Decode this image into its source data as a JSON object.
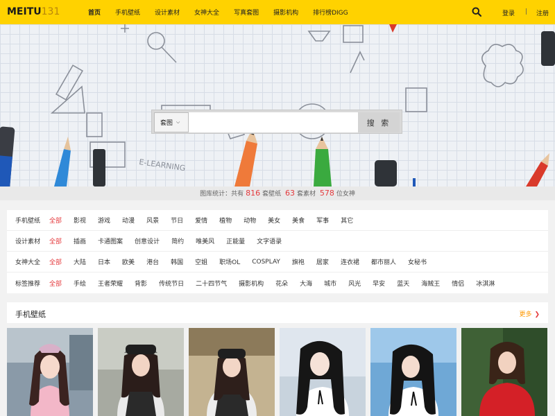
{
  "header": {
    "logo_text": "MEITU",
    "logo_num": "131",
    "nav": [
      "首页",
      "手机壁纸",
      "设计素材",
      "女神大全",
      "写真套图",
      "摄影机构",
      "排行榜DIGG"
    ],
    "login": "登录",
    "separator": "|",
    "register": "注册"
  },
  "search": {
    "select_value": "套图",
    "placeholder": "",
    "button": "搜 索"
  },
  "stats": {
    "prefix": "图库统计：共有",
    "wallpapers": "816",
    "wallpapers_unit": "套壁纸",
    "materials": "63",
    "materials_unit": "套素材",
    "goddess": "578",
    "goddess_unit": "位女神"
  },
  "filters": [
    {
      "cat": "手机壁纸",
      "tags": [
        "全部",
        "影视",
        "游戏",
        "动漫",
        "风景",
        "节日",
        "爱情",
        "植物",
        "动物",
        "美女",
        "美食",
        "军事",
        "其它"
      ]
    },
    {
      "cat": "设计素材",
      "tags": [
        "全部",
        "插画",
        "卡通图案",
        "创意设计",
        "简约",
        "唯美风",
        "正能量",
        "文字语录"
      ]
    },
    {
      "cat": "女神大全",
      "tags": [
        "全部",
        "大陆",
        "日本",
        "欧美",
        "港台",
        "韩国",
        "空姐",
        "职场OL",
        "COSPLAY",
        "旗袍",
        "居家",
        "连衣裙",
        "都市丽人",
        "女秘书"
      ]
    },
    {
      "cat": "标签推荐",
      "tags": [
        "全部",
        "手绘",
        "王者荣耀",
        "背影",
        "传统节日",
        "二十四节气",
        "摄影机构",
        "花朵",
        "大海",
        "城市",
        "风光",
        "早安",
        "蓝天",
        "海贼王",
        "情侣",
        "冰淇淋"
      ]
    }
  ],
  "section": {
    "title": "手机壁纸",
    "more": "更多"
  },
  "banner_text": "E-LEARNING",
  "colors": {
    "brand": "#ffd200",
    "highlight": "#e4393c",
    "more": "#ff9800"
  }
}
